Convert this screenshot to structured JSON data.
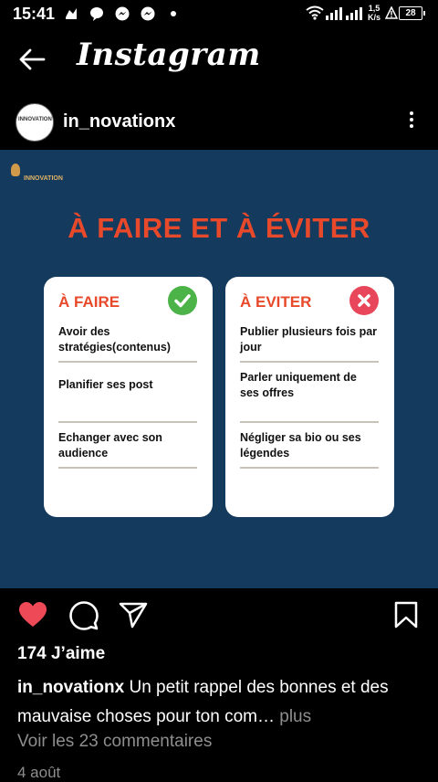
{
  "status_bar": {
    "time": "15:41",
    "speed_value": "1,5",
    "speed_unit": "K/s",
    "battery": "28"
  },
  "header": {
    "brand": "Instagram"
  },
  "post": {
    "username": "in_novationx",
    "image": {
      "logo_text": "INNOVATION",
      "title": "À FAIRE ET À ÉVITER",
      "left_card": {
        "title": "À FAIRE",
        "items": [
          "Avoir des stratégies(contenus)",
          "Planifier ses post",
          "Echanger avec son audience"
        ]
      },
      "right_card": {
        "title": "À EVITER",
        "items": [
          "Publier plusieurs fois par jour",
          "Parler uniquement de ses offres",
          "Négliger sa bio ou ses légendes"
        ]
      }
    },
    "likes": "174 J’aime",
    "caption_user": "in_novationx",
    "caption_text": " Un petit rappel des bonnes et des mauvaise choses pour ton com…",
    "caption_more": " plus",
    "comments_link": "Voir les 23 commentaires",
    "date": "4 août",
    "heart_color": "#ed4956"
  }
}
